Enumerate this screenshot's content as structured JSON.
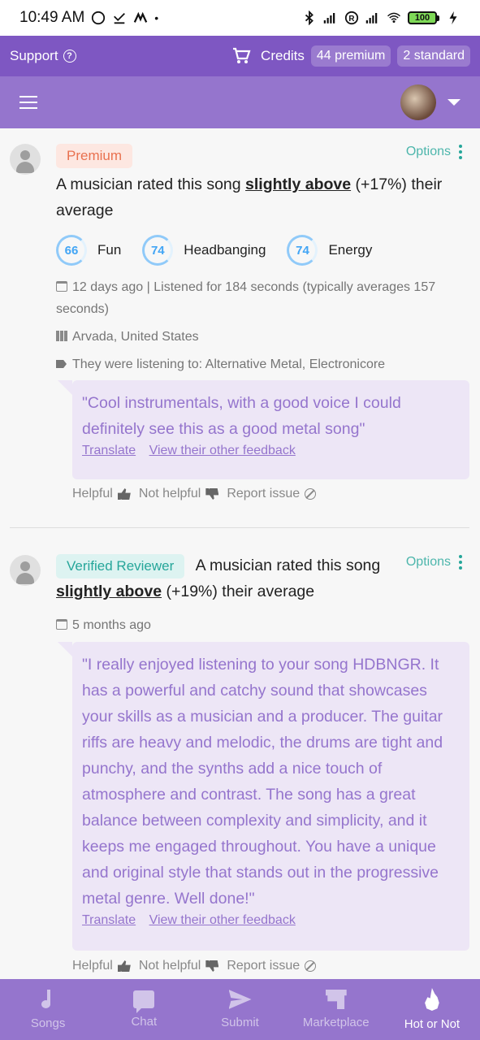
{
  "status_bar": {
    "time": "10:49 AM",
    "battery": "100"
  },
  "support_bar": {
    "support_label": "Support",
    "credits_label": "Credits",
    "premium_credits": "44 premium",
    "standard_credits": "2 standard"
  },
  "reviews": [
    {
      "badge": "Premium",
      "options_label": "Options",
      "headline_prefix": "A musician rated this song",
      "headline_emph": "slightly above",
      "headline_suffix": "(+17%) their average",
      "ratings": [
        {
          "value": "66",
          "label": "Fun"
        },
        {
          "value": "74",
          "label": "Headbanging"
        },
        {
          "value": "74",
          "label": "Energy"
        }
      ],
      "date": "12 days ago",
      "listened": "| Listened for 184 seconds (typically averages 157 seconds)",
      "location": "Arvada, United States",
      "genres": "They were listening to: Alternative Metal, Electronicore",
      "quote": "\"Cool instrumentals, with a good voice I could definitely see this as a good metal song\"",
      "translate_label": "Translate",
      "other_feedback_label": "View their other feedback",
      "helpful_label": "Helpful",
      "not_helpful_label": "Not helpful",
      "report_label": "Report issue"
    },
    {
      "badge": "Verified Reviewer",
      "options_label": "Options",
      "headline_prefix": "A musician rated this song",
      "headline_emph": "slightly above",
      "headline_suffix": "(+19%) their average",
      "date": "5 months ago",
      "quote": "\"I really enjoyed listening to your song HDBNGR. It has a powerful and catchy sound that showcases your skills as a musician and a producer. The guitar riffs are heavy and melodic, the drums are tight and punchy, and the synths add a nice touch of atmosphere and contrast. The song has a great balance between complexity and simplicity, and it keeps me engaged throughout. You have a unique and original style that stands out in the progressive metal genre. Well done!\"",
      "translate_label": "Translate",
      "other_feedback_label": "View their other feedback",
      "helpful_label": "Helpful",
      "not_helpful_label": "Not helpful",
      "report_label": "Report issue"
    }
  ],
  "bottom_nav": [
    {
      "label": "Songs",
      "icon": "music-note-icon",
      "active": false
    },
    {
      "label": "Chat",
      "icon": "chat-icon",
      "active": false
    },
    {
      "label": "Submit",
      "icon": "send-icon",
      "active": false
    },
    {
      "label": "Marketplace",
      "icon": "store-icon",
      "active": false
    },
    {
      "label": "Hot or Not",
      "icon": "fire-icon",
      "active": true
    }
  ],
  "colors": {
    "primary": "#7e57c2",
    "appbar": "#9575cd",
    "accent_teal": "#26a69a",
    "quote_bg": "#ede6f6"
  }
}
